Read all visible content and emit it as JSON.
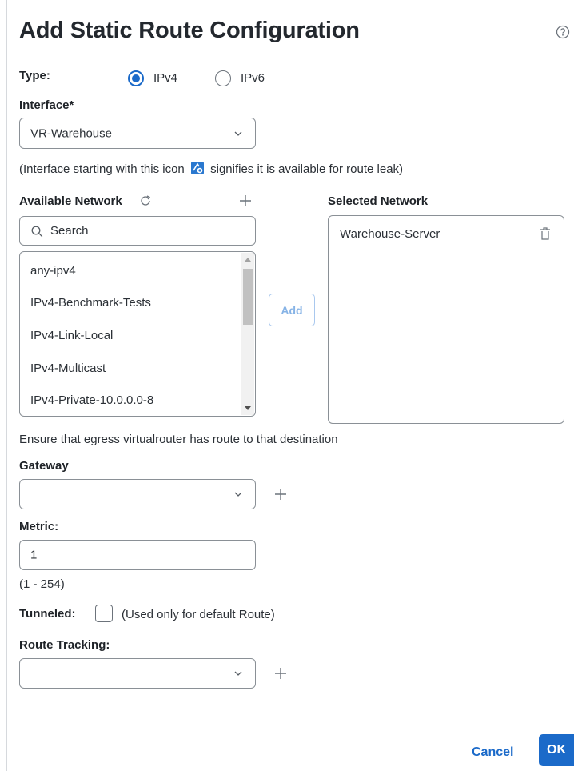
{
  "dialog": {
    "title": "Add Static Route Configuration",
    "help_icon": "help-circle-icon"
  },
  "type": {
    "label": "Type:",
    "options": [
      {
        "label": "IPv4",
        "selected": true
      },
      {
        "label": "IPv6",
        "selected": false
      }
    ]
  },
  "interface": {
    "label": "Interface*",
    "value": "VR-Warehouse",
    "note_before": "(Interface starting with this icon",
    "note_after": "signifies it is available for route leak)",
    "note_icon": "route-leak-icon"
  },
  "available_network": {
    "label": "Available Network",
    "search_placeholder": "Search",
    "items": [
      "any-ipv4",
      "IPv4-Benchmark-Tests",
      "IPv4-Link-Local",
      "IPv4-Multicast",
      "IPv4-Private-10.0.0.0-8"
    ]
  },
  "add_button": "Add",
  "selected_network": {
    "label": "Selected Network",
    "items": [
      "Warehouse-Server"
    ]
  },
  "egress_note": "Ensure that egress virtualrouter has route to that destination",
  "gateway": {
    "label": "Gateway",
    "value": ""
  },
  "metric": {
    "label": "Metric:",
    "value": "1",
    "range": "(1 - 254)"
  },
  "tunneled": {
    "label": "Tunneled:",
    "checked": false,
    "note": "(Used only for default Route)"
  },
  "route_tracking": {
    "label": "Route Tracking:",
    "value": ""
  },
  "footer": {
    "cancel": "Cancel",
    "ok": "OK"
  },
  "colors": {
    "accent": "#1b6ac9",
    "border": "#8a9096"
  }
}
